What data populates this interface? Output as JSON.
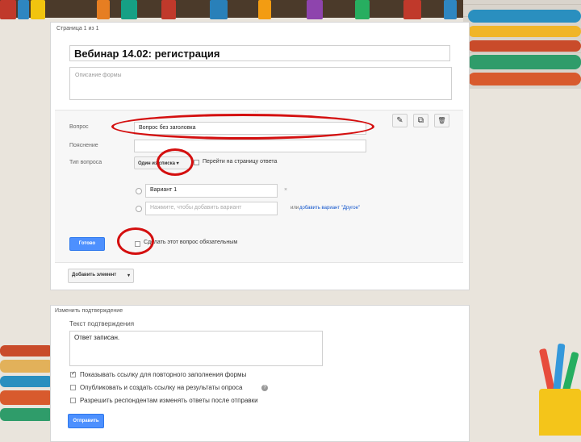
{
  "page_indicator": "Страница 1 из 1",
  "form_title": "Вебинар  14.02: регистрация",
  "form_description_placeholder": "Описание формы",
  "question": {
    "label": "Вопрос",
    "value": "Вопрос без заголовка",
    "help_label": "Пояснение",
    "type_label": "Тип вопроса",
    "type_value": "Один из списка",
    "goto_page_label": "Перейти на страницу ответа",
    "option_1": "Вариант 1",
    "add_option_placeholder": "Нажмите, чтобы добавить вариант",
    "remove_option": "×",
    "add_other_prefix": "или",
    "add_other_link": "добавить вариант \"Другое\"",
    "done_button": "Готово",
    "required_label": "Сделать этот вопрос обязательным",
    "drag_handle": "::::"
  },
  "toolbar": {
    "edit": "✎",
    "copy": "⧉",
    "delete": "🗑"
  },
  "add_item_button": "Добавить элемент",
  "confirmation": {
    "section_label": "Изменить подтверждение",
    "text_label": "Текст подтверждения",
    "text_value": "Ответ записан.",
    "options": [
      {
        "label": "Показывать ссылку для повторного заполнения формы",
        "checked": true
      },
      {
        "label": "Опубликовать и создать ссылку на результаты опроса",
        "checked": false,
        "help": "?"
      },
      {
        "label": "Разрешить респондентам изменять ответы после отправки",
        "checked": false
      }
    ],
    "submit_button": "Отправить"
  },
  "colors": {
    "accent": "#4d90fe",
    "annotation": "#d40f0f"
  }
}
